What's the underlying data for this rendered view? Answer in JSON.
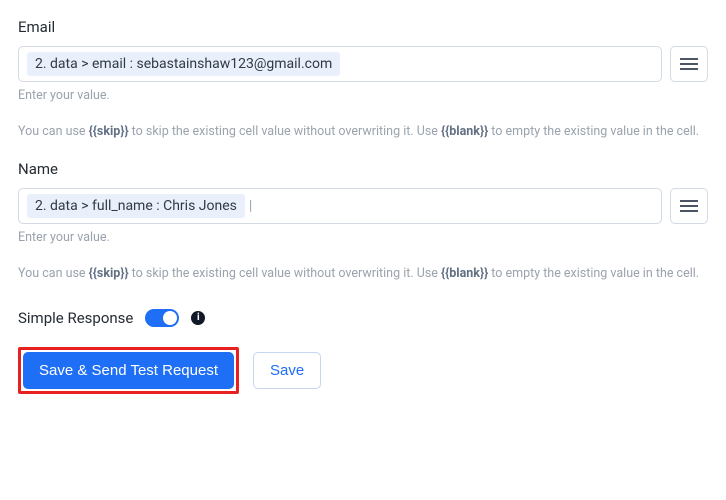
{
  "fields": {
    "email": {
      "label": "Email",
      "chip": "2. data > email : sebastainshaw123@gmail.com",
      "helper": "Enter your value."
    },
    "name": {
      "label": "Name",
      "chip": "2. data > full_name : Chris Jones",
      "helper": "Enter your value."
    }
  },
  "note": {
    "part1": "You can use ",
    "skip_token": "{{skip}}",
    "part2": " to skip the existing cell value without overwriting it. Use ",
    "blank_token": "{{blank}}",
    "part3": " to empty the existing value in the cell."
  },
  "toggle": {
    "label": "Simple Response",
    "on": true
  },
  "buttons": {
    "primary": "Save & Send Test Request",
    "secondary": "Save"
  },
  "icons": {
    "info_glyph": "i"
  }
}
